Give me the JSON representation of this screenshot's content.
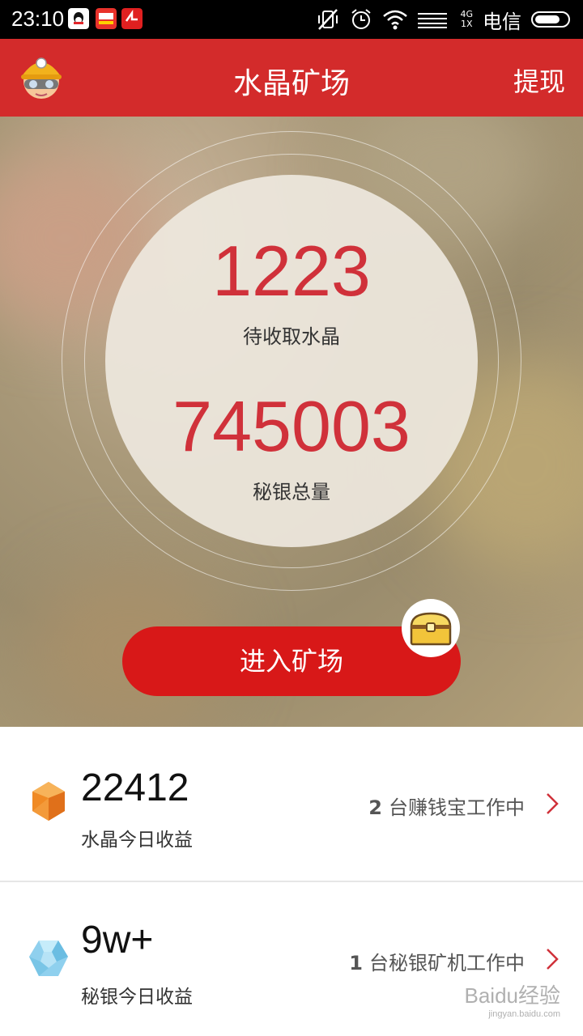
{
  "status_bar": {
    "time": "23:10",
    "network_top": "4G",
    "network_bottom": "1X",
    "carrier": "电信"
  },
  "header": {
    "title": "水晶矿场",
    "withdraw_label": "提现"
  },
  "hero": {
    "pending_crystal_value": "1223",
    "pending_crystal_label": "待收取水晶",
    "silver_total_value": "745003",
    "silver_total_label": "秘银总量",
    "enter_button_label": "进入矿场"
  },
  "info_tag": "i",
  "rows": [
    {
      "value": "22412",
      "label": "水晶今日收益",
      "count": "2",
      "status": "台赚钱宝工作中"
    },
    {
      "value": "9w+",
      "label": "秘银今日收益",
      "count": "1",
      "status": "台秘银矿机工作中"
    }
  ],
  "watermark": {
    "main": "Baidu经验",
    "sub": "jingyan.baidu.com"
  },
  "colors": {
    "header_bg": "#d32b2b",
    "number_red": "#d0313a",
    "button_red": "#d81818"
  }
}
